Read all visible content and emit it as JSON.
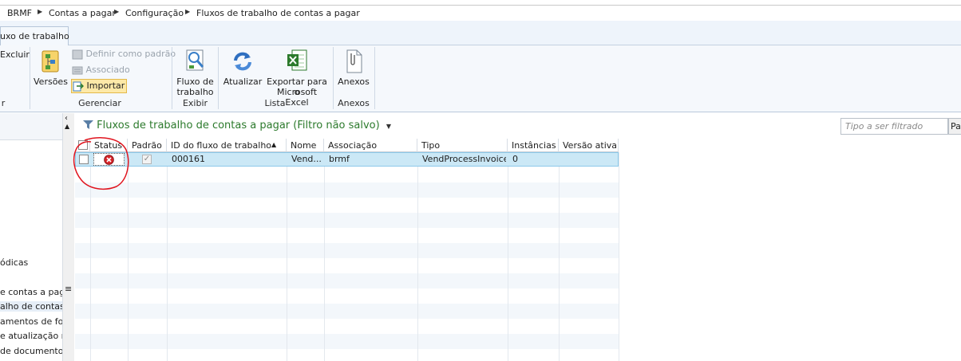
{
  "breadcrumb": {
    "items": [
      "BRMF",
      "Contas a pagar",
      "Configuração",
      "Fluxos de trabalho de contas a pagar"
    ]
  },
  "ribbon": {
    "tab_active": "uxo de trabalho",
    "excluir": "Excluir",
    "group_left_label": "r",
    "versoes": "Versões",
    "definir_padrao": "Definir como padrão",
    "associado": "Associado",
    "importar": "Importar",
    "gerenciar_label": "Gerenciar",
    "fluxo_line1": "Fluxo de",
    "fluxo_line2": "trabalho",
    "exibir_label": "Exibir",
    "atualizar": "Atualizar",
    "exportar_line1": "Exportar para o",
    "exportar_line2": "Microsoft Excel",
    "lista_label": "Lista",
    "anexos": "Anexos",
    "anexos_label": "Anexos"
  },
  "left_panel": {
    "items": [
      "ódicas",
      "e contas a pagar",
      "alho de contas a",
      "amentos de forn",
      "e atualização res",
      "de documento f"
    ]
  },
  "grid": {
    "title": "Fluxos de trabalho de contas a pagar (Filtro não salvo)",
    "filter_placeholder": "Tipo a ser filtrado",
    "filter_button": "Pa",
    "columns": [
      "Status",
      "Padrão",
      "ID do fluxo de trabalho",
      "Nome",
      "Associação",
      "Tipo",
      "Instâncias",
      "Versão ativa"
    ],
    "rows": [
      {
        "id": "000161",
        "nome": "Vend...",
        "associacao": "brmf",
        "tipo": "VendProcessInvoice",
        "instancias": "0",
        "versao_ativa": ""
      }
    ]
  },
  "colors": {
    "title_green": "#2c7a2c",
    "selection": "#cbe8f6",
    "annotation_red": "#e0141e"
  }
}
